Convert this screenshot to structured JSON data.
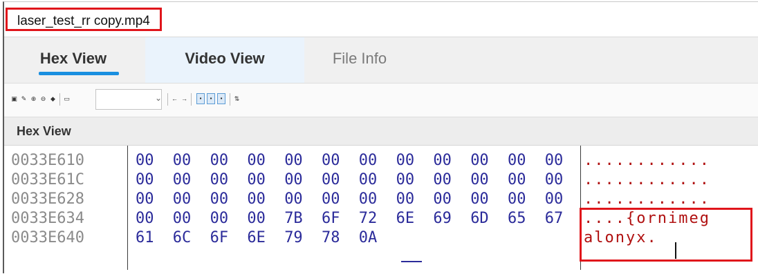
{
  "window": {
    "filename": "laser_test_rr copy.mp4"
  },
  "tabs": [
    {
      "label": "Hex View",
      "active": true
    },
    {
      "label": "Video View",
      "active": false
    },
    {
      "label": "File Info",
      "active": false
    }
  ],
  "toolbar": {
    "icons": [
      "save-icon",
      "edit-icon",
      "zoom-in-icon",
      "zoom-out-icon",
      "bookmark-icon",
      "print-icon",
      "back-icon",
      "forward-icon",
      "view-mode-1-icon",
      "view-mode-2-icon",
      "view-mode-3-icon",
      "sort-icon"
    ],
    "combo_value": ""
  },
  "section_label": "Hex View",
  "hex": {
    "rows": [
      {
        "offset": "0033E610",
        "bytes": [
          "00",
          "00",
          "00",
          "00",
          "00",
          "00",
          "00",
          "00",
          "00",
          "00",
          "00",
          "00"
        ],
        "ascii": "............"
      },
      {
        "offset": "0033E61C",
        "bytes": [
          "00",
          "00",
          "00",
          "00",
          "00",
          "00",
          "00",
          "00",
          "00",
          "00",
          "00",
          "00"
        ],
        "ascii": "............"
      },
      {
        "offset": "0033E628",
        "bytes": [
          "00",
          "00",
          "00",
          "00",
          "00",
          "00",
          "00",
          "00",
          "00",
          "00",
          "00",
          "00"
        ],
        "ascii": "............"
      },
      {
        "offset": "0033E634",
        "bytes": [
          "00",
          "00",
          "00",
          "00",
          "7B",
          "6F",
          "72",
          "6E",
          "69",
          "6D",
          "65",
          "67"
        ],
        "ascii": "....{ornimeg"
      },
      {
        "offset": "0033E640",
        "bytes": [
          "61",
          "6C",
          "6F",
          "6E",
          "79",
          "78",
          "0A"
        ],
        "ascii": "alonyx."
      }
    ]
  },
  "colors": {
    "highlight": "#e0151b",
    "tab_accent": "#1a8fe0",
    "hex_bytes": "#2b2b9a",
    "ascii_text": "#b01010",
    "offset_text": "#8a8a8a"
  }
}
